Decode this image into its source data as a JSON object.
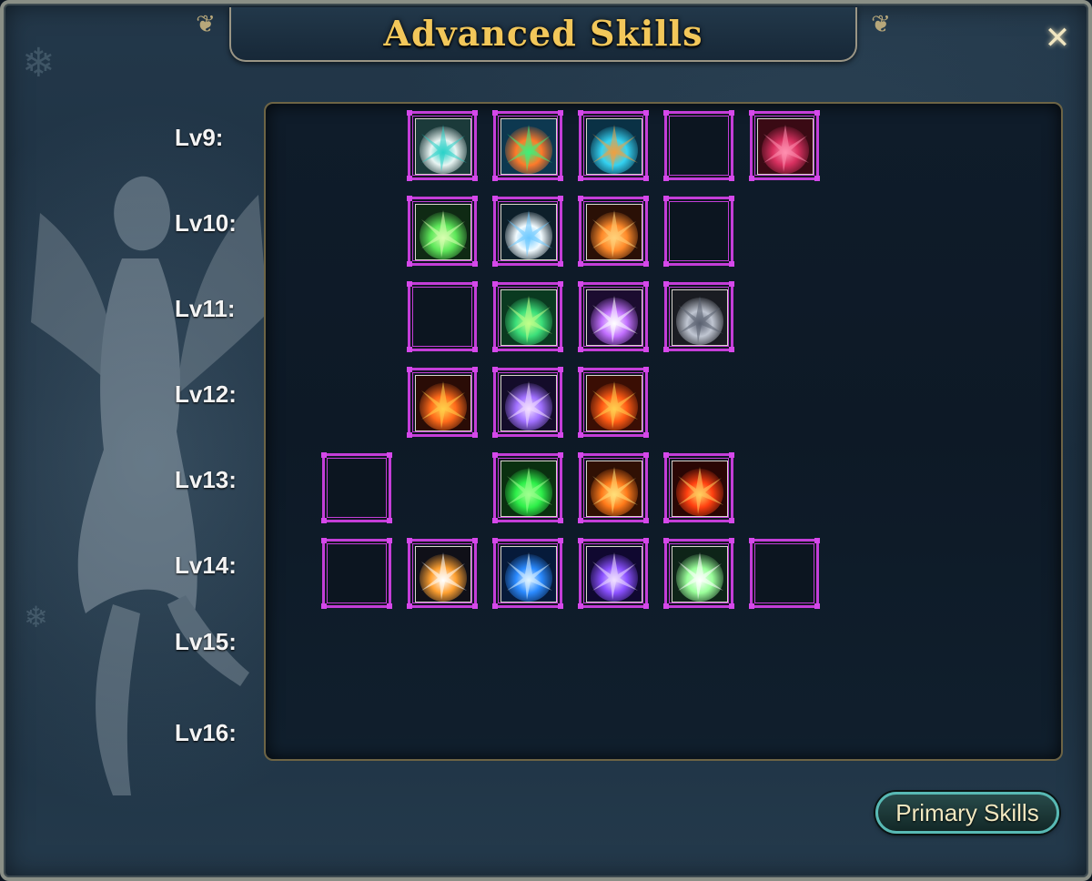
{
  "window": {
    "title": "Advanced Skills",
    "close_symbol": "✕"
  },
  "levels": [
    {
      "label": "Lv9:"
    },
    {
      "label": "Lv10:"
    },
    {
      "label": "Lv11:"
    },
    {
      "label": "Lv12:"
    },
    {
      "label": "Lv13:"
    },
    {
      "label": "Lv14:"
    },
    {
      "label": "Lv15:"
    },
    {
      "label": "Lv16:"
    }
  ],
  "skill_rows": [
    {
      "level": "Lv9:",
      "slots": [
        {
          "col": 1,
          "icon": "yin-yang-skill-icon",
          "filled": true
        },
        {
          "col": 2,
          "icon": "rainbow-burst-skill-icon",
          "filled": true
        },
        {
          "col": 3,
          "icon": "cyan-ring-skill-icon",
          "filled": true
        },
        {
          "col": 4,
          "icon": "",
          "filled": false
        },
        {
          "col": 5,
          "icon": "crimson-thorn-skill-icon",
          "filled": true
        }
      ]
    },
    {
      "level": "Lv10:",
      "slots": [
        {
          "col": 1,
          "icon": "green-spikes-skill-icon",
          "filled": true
        },
        {
          "col": 2,
          "icon": "white-orb-skill-icon",
          "filled": true
        },
        {
          "col": 3,
          "icon": "fire-slash-skill-icon",
          "filled": true
        },
        {
          "col": 4,
          "icon": "",
          "filled": false
        }
      ]
    },
    {
      "level": "Lv11:",
      "slots": [
        {
          "col": 1,
          "icon": "",
          "filled": false
        },
        {
          "col": 2,
          "icon": "green-wind-skill-icon",
          "filled": true
        },
        {
          "col": 3,
          "icon": "violet-spark-skill-icon",
          "filled": true
        },
        {
          "col": 4,
          "icon": "scythe-skill-icon",
          "filled": true
        }
      ]
    },
    {
      "level": "Lv12:",
      "slots": [
        {
          "col": 1,
          "icon": "phoenix-skill-icon",
          "filled": true
        },
        {
          "col": 2,
          "icon": "vortex-skill-icon",
          "filled": true
        },
        {
          "col": 3,
          "icon": "flame-wall-skill-icon",
          "filled": true
        }
      ]
    },
    {
      "level": "Lv13:",
      "slots": [
        {
          "col": 0,
          "icon": "",
          "filled": false
        },
        {
          "col": 2,
          "icon": "green-rain-skill-icon",
          "filled": true
        },
        {
          "col": 3,
          "icon": "fire-swirl-skill-icon",
          "filled": true
        },
        {
          "col": 4,
          "icon": "lava-crack-skill-icon",
          "filled": true
        }
      ]
    },
    {
      "level": "Lv14:",
      "slots": [
        {
          "col": 0,
          "icon": "",
          "filled": false
        },
        {
          "col": 1,
          "icon": "meteor-skill-icon",
          "filled": true
        },
        {
          "col": 2,
          "icon": "blue-flash-skill-icon",
          "filled": true
        },
        {
          "col": 3,
          "icon": "purple-pillar-skill-icon",
          "filled": true
        },
        {
          "col": 4,
          "icon": "light-burst-skill-icon",
          "filled": true
        },
        {
          "col": 5,
          "icon": "",
          "filled": false
        }
      ]
    }
  ],
  "footer": {
    "primary_button_label": "Primary Skills"
  },
  "colors": {
    "title": "#f2c75a",
    "slot_border": "#c43ed8",
    "button_border": "#58b9b4"
  }
}
